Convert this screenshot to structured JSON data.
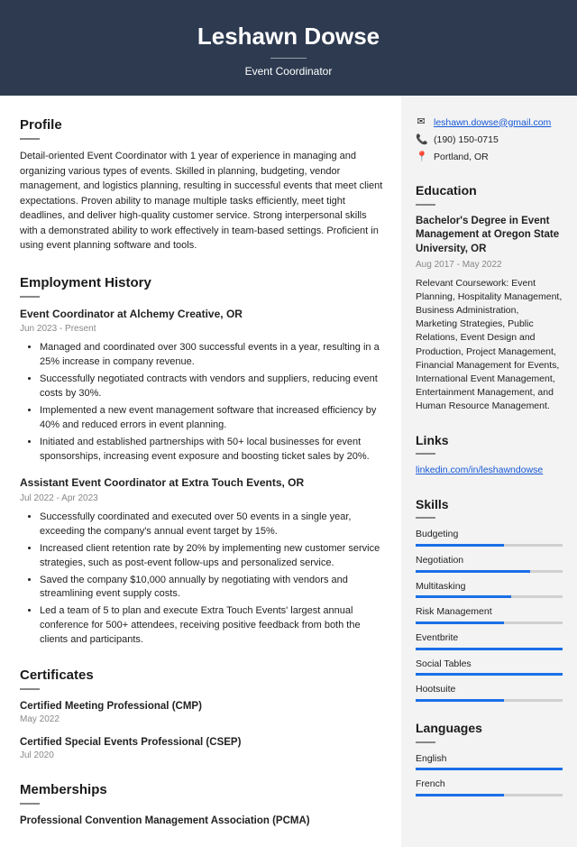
{
  "header": {
    "name": "Leshawn Dowse",
    "title": "Event Coordinator"
  },
  "profile": {
    "heading": "Profile",
    "text": "Detail-oriented Event Coordinator with 1 year of experience in managing and organizing various types of events. Skilled in planning, budgeting, vendor management, and logistics planning, resulting in successful events that meet client expectations. Proven ability to manage multiple tasks efficiently, meet tight deadlines, and deliver high-quality customer service. Strong interpersonal skills with a demonstrated ability to work effectively in team-based settings. Proficient in using event planning software and tools."
  },
  "employment": {
    "heading": "Employment History",
    "jobs": [
      {
        "title": "Event Coordinator at Alchemy Creative, OR",
        "date": "Jun 2023 - Present",
        "bullets": [
          "Managed and coordinated over 300 successful events in a year, resulting in a 25% increase in company revenue.",
          "Successfully negotiated contracts with vendors and suppliers, reducing event costs by 30%.",
          "Implemented a new event management software that increased efficiency by 40% and reduced errors in event planning.",
          "Initiated and established partnerships with 50+ local businesses for event sponsorships, increasing event exposure and boosting ticket sales by 20%."
        ]
      },
      {
        "title": "Assistant Event Coordinator at Extra Touch Events, OR",
        "date": "Jul 2022 - Apr 2023",
        "bullets": [
          "Successfully coordinated and executed over 50 events in a single year, exceeding the company's annual event target by 15%.",
          "Increased client retention rate by 20% by implementing new customer service strategies, such as post-event follow-ups and personalized service.",
          "Saved the company $10,000 annually by negotiating with vendors and streamlining event supply costs.",
          "Led a team of 5 to plan and execute Extra Touch Events' largest annual conference for 500+ attendees, receiving positive feedback from both the clients and participants."
        ]
      }
    ]
  },
  "certificates": {
    "heading": "Certificates",
    "items": [
      {
        "title": "Certified Meeting Professional (CMP)",
        "date": "May 2022"
      },
      {
        "title": "Certified Special Events Professional (CSEP)",
        "date": "Jul 2020"
      }
    ]
  },
  "memberships": {
    "heading": "Memberships",
    "items": [
      {
        "title": "Professional Convention Management Association (PCMA)"
      }
    ]
  },
  "contact": {
    "email": "leshawn.dowse@gmail.com",
    "phone": "(190) 150-0715",
    "location": "Portland, OR"
  },
  "education": {
    "heading": "Education",
    "degree": "Bachelor's Degree in Event Management at Oregon State University, OR",
    "date": "Aug 2017 - May 2022",
    "text": "Relevant Coursework: Event Planning, Hospitality Management, Business Administration, Marketing Strategies, Public Relations, Event Design and Production, Project Management, Financial Management for Events, International Event Management, Entertainment Management, and Human Resource Management."
  },
  "links": {
    "heading": "Links",
    "url": "linkedin.com/in/leshawndowse"
  },
  "skills": {
    "heading": "Skills",
    "items": [
      {
        "name": "Budgeting",
        "level": 60
      },
      {
        "name": "Negotiation",
        "level": 78
      },
      {
        "name": "Multitasking",
        "level": 65
      },
      {
        "name": "Risk Management",
        "level": 60
      },
      {
        "name": "Eventbrite",
        "level": 100
      },
      {
        "name": "Social Tables",
        "level": 100
      },
      {
        "name": "Hootsuite",
        "level": 60
      }
    ]
  },
  "languages": {
    "heading": "Languages",
    "items": [
      {
        "name": "English",
        "level": 100
      },
      {
        "name": "French",
        "level": 60
      }
    ]
  }
}
